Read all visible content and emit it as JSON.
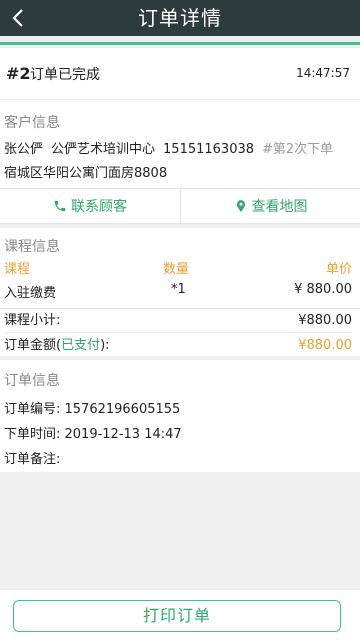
{
  "header": {
    "title": "订单详情",
    "back_icon": "chevron-left-icon"
  },
  "order": {
    "number": "#2",
    "status": "订单已完成",
    "time": "14:47:57"
  },
  "customer": {
    "section_title": "客户信息",
    "name": "张公俨",
    "organization": "公俨艺术培训中心",
    "phone": "15151163038",
    "order_count": "#第2次下单",
    "address": "宿城区华阳公寓门面房8808"
  },
  "actions": {
    "contact_label": "联系顾客",
    "contact_icon": "phone-icon",
    "map_label": "查看地图",
    "map_icon": "map-pin-icon"
  },
  "course": {
    "section_title": "课程信息",
    "columns": {
      "course": "课程",
      "quantity": "数量",
      "price": "单价"
    },
    "items": [
      {
        "name": "入驻缴费",
        "quantity": "*1",
        "price": "¥ 880.00"
      }
    ],
    "subtotal_label": "课程小计:",
    "subtotal_value": "¥880.00",
    "total_label_prefix": "订单金额(",
    "total_paid": "已支付",
    "total_label_suffix": "):",
    "total_value": "¥880.00"
  },
  "order_info": {
    "section_title": "订单信息",
    "number_line": "订单编号: 15762196605155",
    "time_line": "下单时间: 2019-12-13 14:47",
    "note_line": "订单备注:"
  },
  "footer": {
    "print_label": "打印订单"
  },
  "colors": {
    "header_bg": "#2e3b3d",
    "accent_green": "#3cc28b",
    "orange": "#f0a030"
  }
}
